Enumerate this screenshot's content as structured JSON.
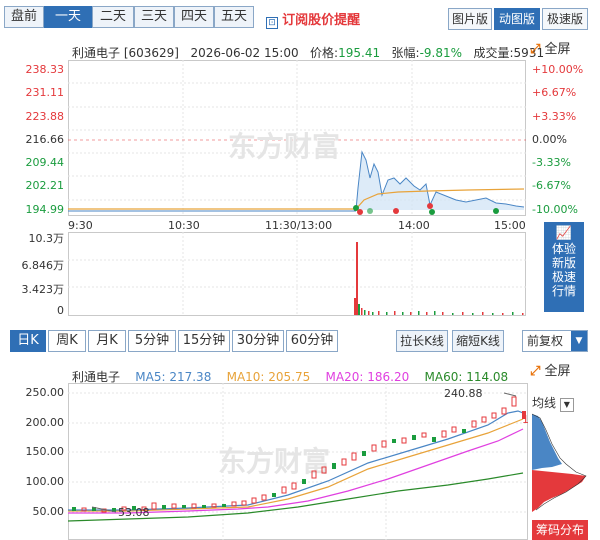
{
  "top_tabs": [
    {
      "label": "盘前",
      "active": false
    },
    {
      "label": "一天",
      "active": true
    },
    {
      "label": "二天",
      "active": false
    },
    {
      "label": "三天",
      "active": false
    },
    {
      "label": "四天",
      "active": false
    },
    {
      "label": "五天",
      "active": false
    }
  ],
  "subscribe_label": "订阅股价提醒",
  "view_buttons": [
    {
      "label": "图片版",
      "active": false
    },
    {
      "label": "动图版",
      "active": true
    },
    {
      "label": "极速版",
      "active": false
    }
  ],
  "fullscreen_label": "全屏",
  "quote": {
    "name_code": "利通电子 [603629]",
    "datetime": "2026-06-02 15:00",
    "price_label": "价格:",
    "price": "195.41",
    "change_label": "张幅:",
    "change": "-9.81%",
    "volume_label": "成交量:",
    "volume": "5931"
  },
  "intraday": {
    "price_ticks": [
      "238.33",
      "231.11",
      "223.88",
      "216.66",
      "209.44",
      "202.21",
      "194.99"
    ],
    "pct_ticks": [
      "+10.00%",
      "+6.67%",
      "+3.33%",
      "0.00%",
      "-3.33%",
      "-6.67%",
      "-10.00%"
    ],
    "time_ticks": [
      "9:30",
      "10:30",
      "11:30/13:00",
      "14:00",
      "15:00"
    ],
    "volume_ticks": [
      "10.3万",
      "6.846万",
      "3.423万",
      "0"
    ],
    "colors": {
      "price_line": "#4a86c5",
      "avg_line": "#e8a33a",
      "up": "#e4393c",
      "down": "#1a9c3e"
    }
  },
  "promo": {
    "line1": "体验",
    "line2": "新版",
    "line3": "极速",
    "line4": "行情"
  },
  "kline_tabs": [
    {
      "label": "日K",
      "active": true
    },
    {
      "label": "周K",
      "active": false
    },
    {
      "label": "月K",
      "active": false
    },
    {
      "label": "5分钟",
      "active": false
    },
    {
      "label": "15分钟",
      "active": false
    },
    {
      "label": "30分钟",
      "active": false
    },
    {
      "label": "60分钟",
      "active": false
    }
  ],
  "kline_buttons": [
    "拉长K线",
    "缩短K线"
  ],
  "adjust_select": "前复权",
  "ma": {
    "name": "利通电子",
    "ma5": "MA5: 217.38",
    "ma10": "MA10: 205.75",
    "ma20": "MA20: 186.20",
    "ma60": "MA60: 114.08",
    "colors": {
      "ma5": "#4a86c5",
      "ma10": "#e8a33a",
      "ma20": "#e040e0",
      "ma60": "#2a8a2a"
    }
  },
  "kline_axis": [
    "250.00",
    "200.00",
    "150.00",
    "100.00",
    "50.00"
  ],
  "kline_annotations": {
    "high": "240.88",
    "low": "53.08",
    "right_mark": "1"
  },
  "junxian_label": "均线",
  "chip_label": "筹码分布",
  "watermark": "东方财富"
}
